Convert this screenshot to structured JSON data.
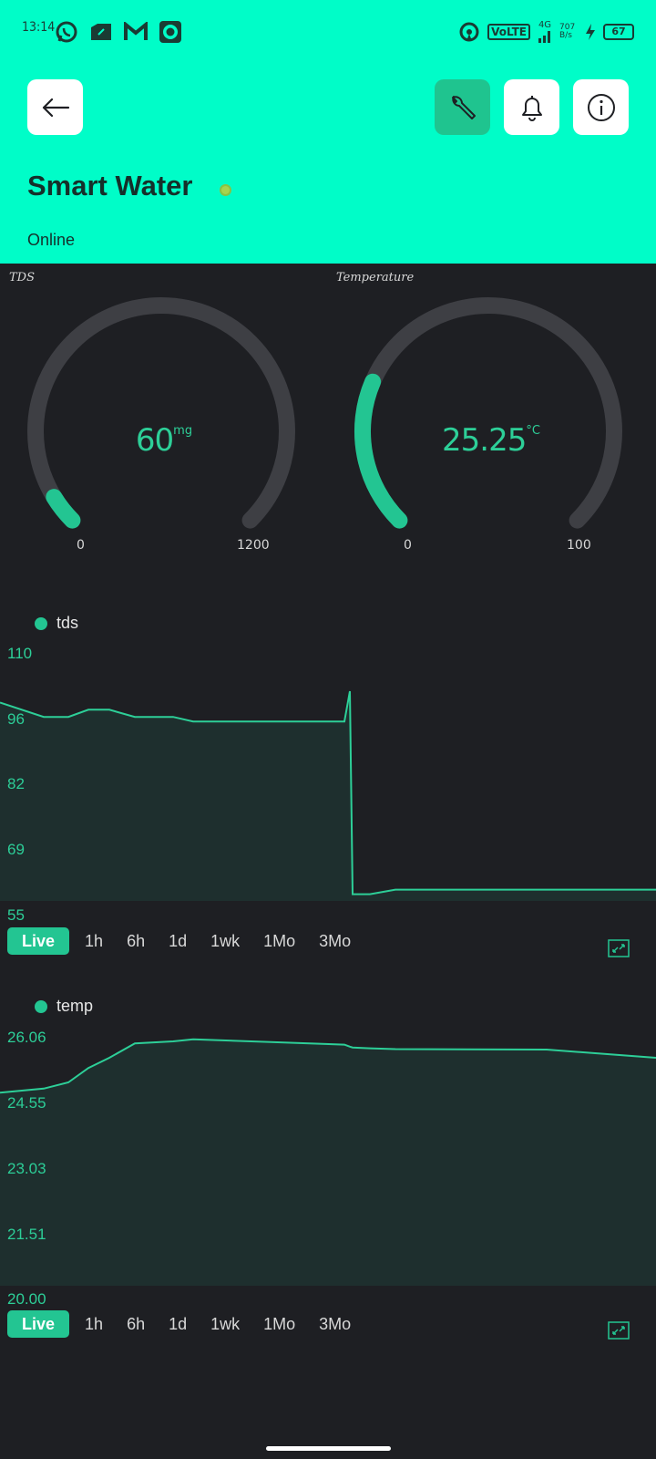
{
  "status_bar": {
    "time": "13:14",
    "network": "4G",
    "volte": "VoLTE",
    "data_speed": "707 B/s",
    "battery": "67"
  },
  "header": {
    "title": "Smart Water",
    "status": "Online",
    "colors": {
      "background": "#00fdc8",
      "online_dot": "#a6d44f",
      "active_button": "#1fc48f"
    }
  },
  "gauges": [
    {
      "title": "TDS",
      "value": "60",
      "unit": "mg",
      "min": "0",
      "max": "1200",
      "fraction": 0.05
    },
    {
      "title": "Temperature",
      "value": "25.25",
      "unit": "°C",
      "min": "0",
      "max": "100",
      "fraction": 0.2525
    }
  ],
  "charts": [
    {
      "legend": "tds",
      "y_ticks": [
        "110",
        "96",
        "82",
        "69",
        "55"
      ],
      "ranges": [
        "Live",
        "1h",
        "6h",
        "1d",
        "1wk",
        "1Mo",
        "3Mo"
      ],
      "active_range": "Live"
    },
    {
      "legend": "temp",
      "y_ticks": [
        "26.06",
        "24.55",
        "23.03",
        "21.51",
        "20.00"
      ],
      "ranges": [
        "Live",
        "1h",
        "6h",
        "1d",
        "1wk",
        "1Mo",
        "3Mo"
      ],
      "active_range": "Live"
    }
  ],
  "chart_data": [
    {
      "type": "area",
      "series": [
        {
          "name": "tds",
          "values": [
            99,
            95.8,
            95.8,
            97.4,
            97.4,
            95.8,
            95.8,
            94.8,
            94.8,
            101.5,
            56.5,
            56.5,
            57.5,
            57.5,
            57.5
          ]
        }
      ],
      "ylim": [
        55,
        110
      ],
      "color": "#2dcf98"
    },
    {
      "type": "area",
      "series": [
        {
          "name": "temp",
          "values": [
            24.7,
            24.8,
            24.95,
            25.3,
            25.55,
            25.9,
            25.95,
            26.0,
            25.87,
            25.82,
            25.8,
            25.78,
            25.76,
            25.75,
            25.55
          ]
        }
      ],
      "ylim": [
        20.0,
        26.06
      ],
      "color": "#2dcf98"
    }
  ]
}
